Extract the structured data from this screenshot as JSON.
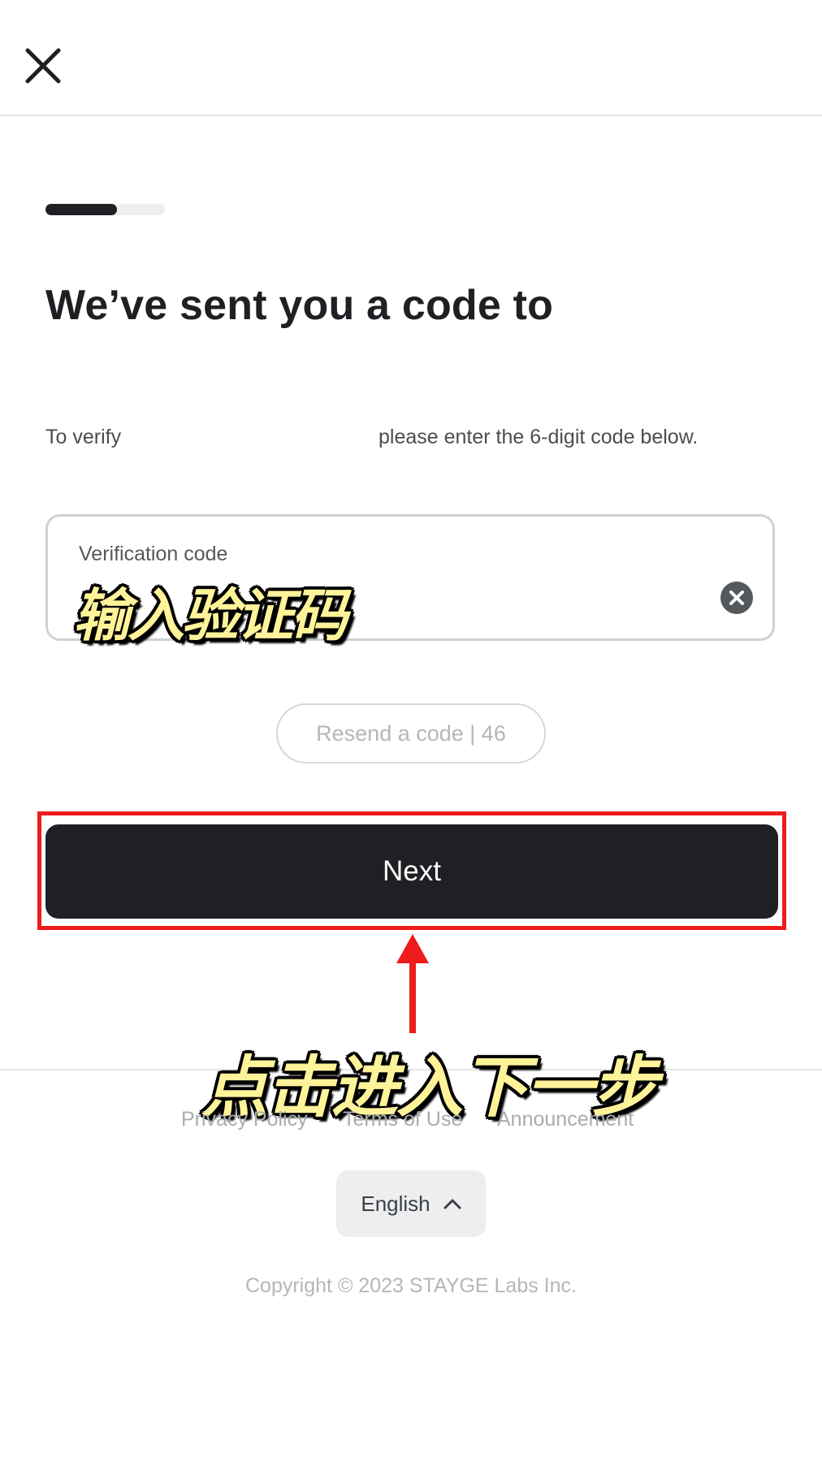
{
  "header": {
    "close_icon": "close-icon"
  },
  "progress": {
    "fraction": 0.6
  },
  "main": {
    "title": "We’ve sent you a code to",
    "verify_text_before": "To verify",
    "verify_text_after": "please enter the 6-digit code below.",
    "code_field": {
      "label": "Verification code",
      "value": "",
      "clear_icon": "x-circle-icon"
    },
    "resend_label": "Resend a code | 46",
    "next_label": "Next"
  },
  "annotations": {
    "input_hint": "输入验证码",
    "next_hint": "点击进入下一步",
    "highlight_color": "#ee1c1c",
    "arrow_color": "#ee1c1c"
  },
  "footer": {
    "links": [
      "Privacy Policy",
      "Terms of Use",
      "Announcement"
    ],
    "language": "English",
    "language_icon": "chevron-up-icon",
    "copyright": "Copyright © 2023 STAYGE Labs Inc."
  }
}
